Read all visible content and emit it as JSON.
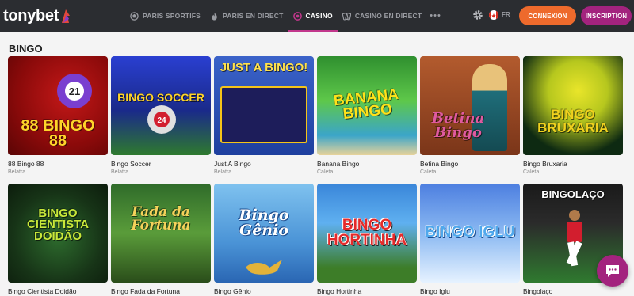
{
  "header": {
    "logo_text": "tonybet",
    "nav": [
      {
        "label": "PARIS SPORTIFS",
        "icon": "ball-icon",
        "active": false
      },
      {
        "label": "PARIS EN DIRECT",
        "icon": "fire-icon",
        "active": false
      },
      {
        "label": "CASINO",
        "icon": "casino-chip-icon",
        "active": true
      },
      {
        "label": "CASINO EN DIRECT",
        "icon": "cards-icon",
        "active": false
      }
    ],
    "more": "•••",
    "language": "FR",
    "login_label": "CONNEXION",
    "signup_label": "INSCRIPTION"
  },
  "section": {
    "title": "BINGO"
  },
  "games": [
    {
      "name": "88 Bingo 88",
      "provider": "Belatra",
      "art": "88 BINGO 88"
    },
    {
      "name": "Bingo Soccer",
      "provider": "Belatra",
      "art": "BINGO SOCCER"
    },
    {
      "name": "Just A Bingo",
      "provider": "Belatra",
      "art": "JUST A BINGO!"
    },
    {
      "name": "Banana Bingo",
      "provider": "Caleta",
      "art": "BANANA BINGO"
    },
    {
      "name": "Betina Bingo",
      "provider": "Caleta",
      "art": "Betina Bingo"
    },
    {
      "name": "Bingo Bruxaria",
      "provider": "Caleta",
      "art": "BINGO BRUXARIA"
    },
    {
      "name": "Bingo Cientista Doidão",
      "provider": "",
      "art": "BINGO CIENTISTA DOIDÃO"
    },
    {
      "name": "Bingo Fada da Fortuna",
      "provider": "",
      "art": "Fada da Fortuna"
    },
    {
      "name": "Bingo Gênio",
      "provider": "",
      "art": "Bingo Gênio"
    },
    {
      "name": "Bingo Hortinha",
      "provider": "",
      "art": "BINGO HORTINHA"
    },
    {
      "name": "Bingo Iglu",
      "provider": "",
      "art": "BINGO IGLU"
    },
    {
      "name": "Bingolaço",
      "provider": "",
      "art": "BINGOLAÇO"
    }
  ],
  "colors": {
    "topbar": "#2b2d31",
    "accent": "#c2378c",
    "login": "#ee6a2c",
    "signup": "#a3237e"
  }
}
